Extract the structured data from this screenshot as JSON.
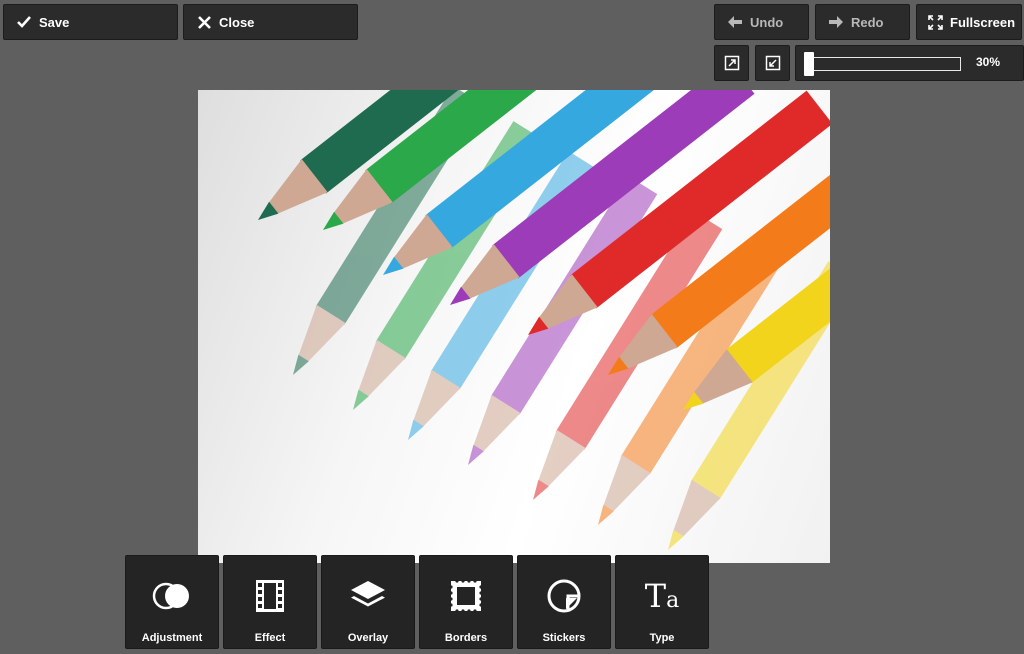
{
  "topbar": {
    "save_label": "Save",
    "close_label": "Close",
    "undo_label": "Undo",
    "redo_label": "Redo",
    "fullscreen_label": "Fullscreen"
  },
  "zoom": {
    "value_label": "30%",
    "level_percent": 30
  },
  "toolbar": {
    "items": [
      {
        "label": "Adjustment",
        "icon": "adjustment-icon"
      },
      {
        "label": "Effect",
        "icon": "film-strip-icon"
      },
      {
        "label": "Overlay",
        "icon": "layers-icon"
      },
      {
        "label": "Borders",
        "icon": "borders-icon"
      },
      {
        "label": "Stickers",
        "icon": "sticker-icon"
      },
      {
        "label": "Type",
        "icon": "type-icon"
      }
    ]
  },
  "canvas": {
    "image": "colored-pencils-photo",
    "pencil_colors": [
      "#1f6b4f",
      "#2aa84a",
      "#36a8e0",
      "#9c3cb8",
      "#e02a2a",
      "#f47b1a",
      "#f2d41c"
    ]
  },
  "colors": {
    "background": "#5f5f5f",
    "panel": "#2b2b2b",
    "text": "#ffffff"
  }
}
